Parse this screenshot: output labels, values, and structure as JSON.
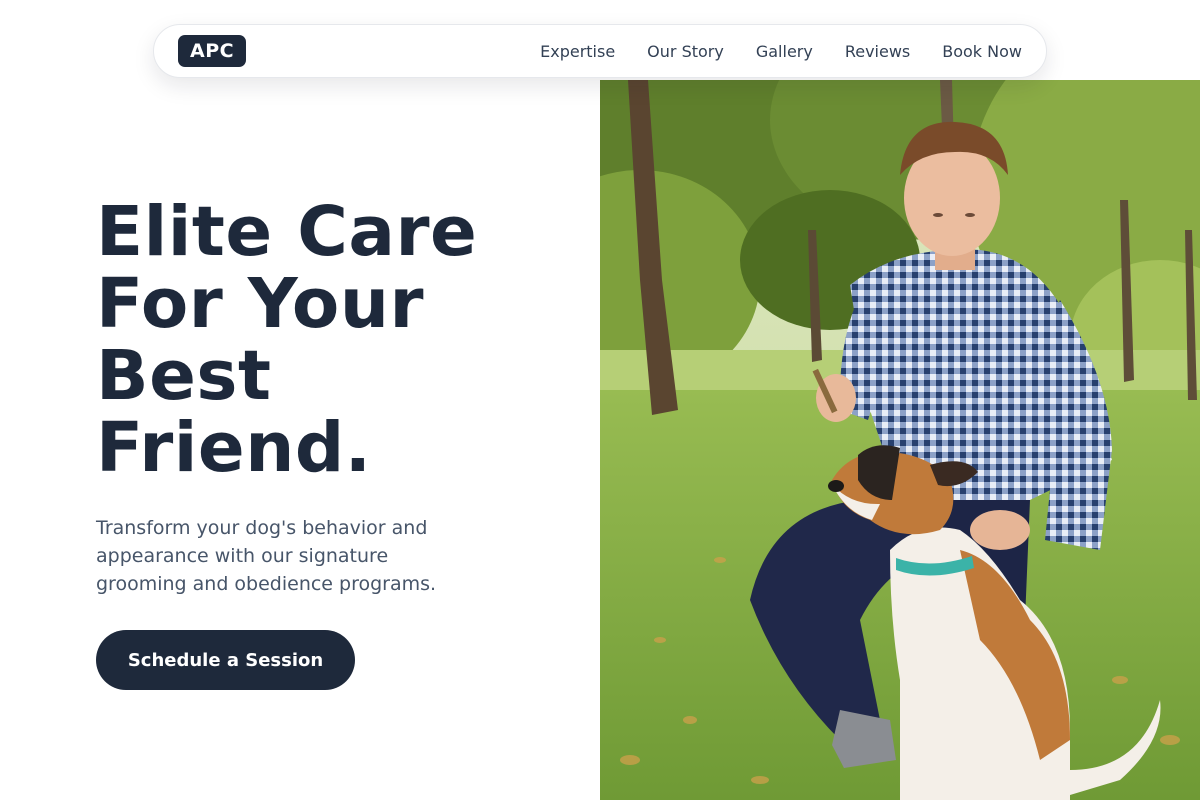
{
  "nav": {
    "logo": "APC",
    "links": [
      "Expertise",
      "Our Story",
      "Gallery",
      "Reviews",
      "Book Now"
    ]
  },
  "hero": {
    "title_lines": [
      "Elite Care",
      "For Your",
      "Best",
      "Friend."
    ],
    "subtitle": "Transform your dog's behavior and appearance with our signature grooming and obedience programs.",
    "cta_label": "Schedule a Session",
    "image_subject": "young man in blue gingham shirt kneeling in a park, training a tan and white dog with a teal collar"
  },
  "colors": {
    "primary_dark": "#1e293b",
    "text_muted": "#475569",
    "nav_text": "#334155",
    "background": "#ffffff"
  }
}
